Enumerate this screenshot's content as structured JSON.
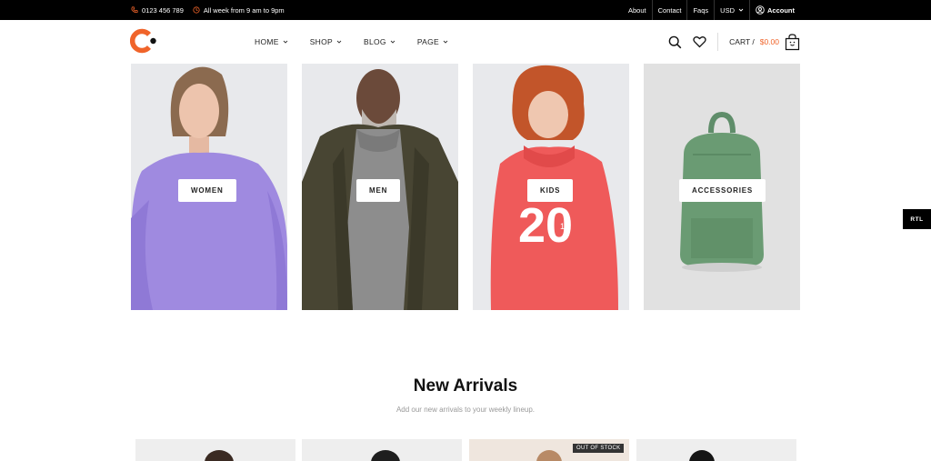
{
  "topbar": {
    "phone": "0123 456 789",
    "hours": "All week from 9 am to 9pm",
    "links": [
      "About",
      "Contact",
      "Faqs"
    ],
    "currency": "USD",
    "account": "Account"
  },
  "nav": {
    "items": [
      {
        "label": "HOME"
      },
      {
        "label": "SHOP"
      },
      {
        "label": "BLOG"
      },
      {
        "label": "PAGE"
      }
    ]
  },
  "cart": {
    "label": "CART /",
    "total": "$0.00"
  },
  "brand": {
    "accent": "#f0642a"
  },
  "categories": [
    {
      "label": "WOMEN"
    },
    {
      "label": "MEN"
    },
    {
      "label": "KIDS"
    },
    {
      "label": "ACCESSORIES"
    }
  ],
  "rtl_label": "RTL",
  "new_arrivals": {
    "title": "New Arrivals",
    "subtitle": "Add our new arrivals to your weekly lineup.",
    "badge": "OUT OF STOCK"
  }
}
